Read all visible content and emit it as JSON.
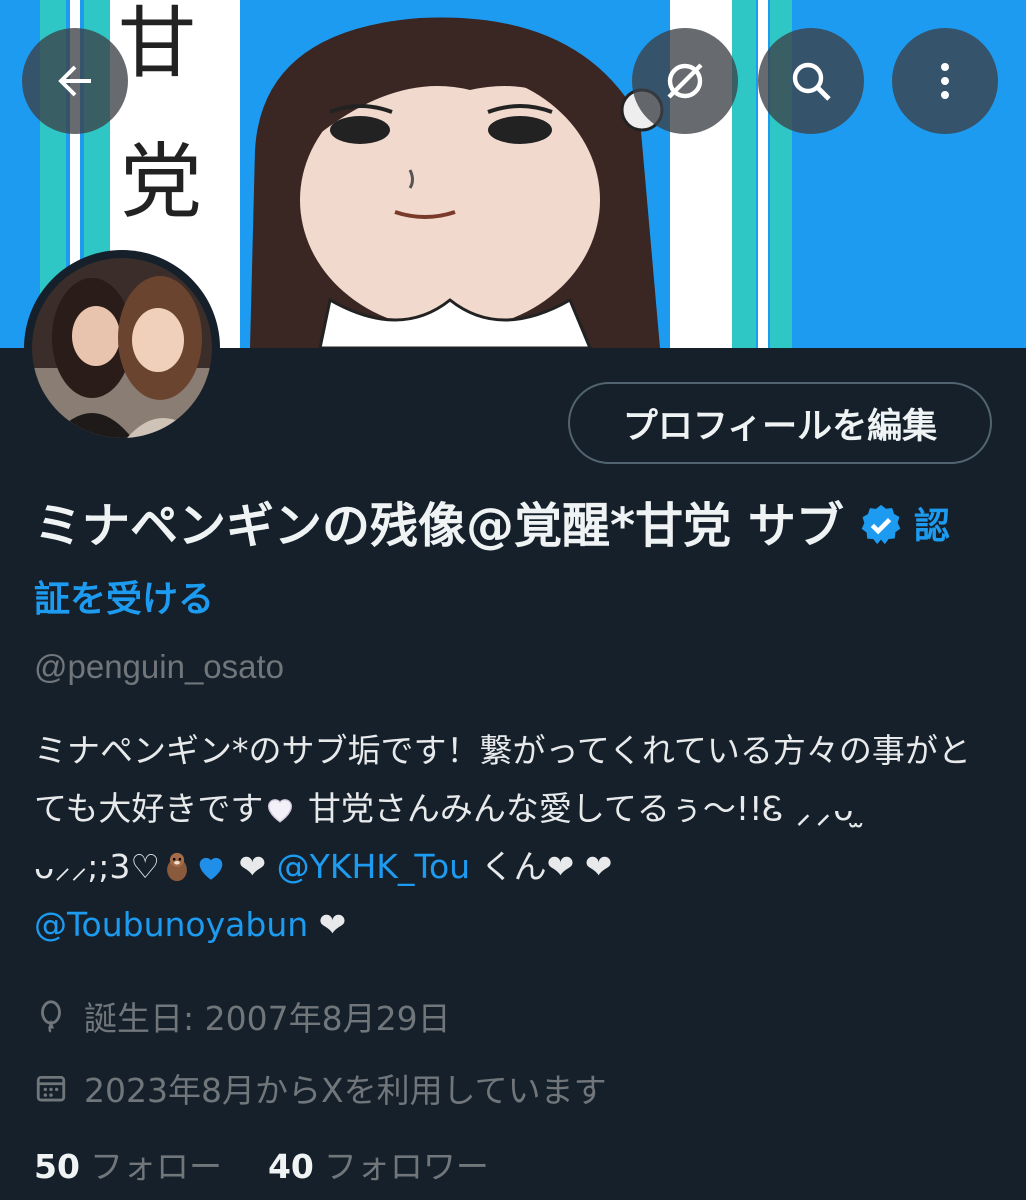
{
  "header": {
    "back_icon": "arrow-left-icon",
    "grok_icon": "grok-icon",
    "search_icon": "search-icon",
    "more_icon": "more-vertical-icon"
  },
  "banner": {
    "text_1": "甘",
    "text_2": "党"
  },
  "profile": {
    "edit_button": "プロフィールを編集",
    "display_name": "ミナペンギンの残像@覚醒*甘党 サブ",
    "verify_cta": "認証を受ける",
    "handle": "@penguin_osato"
  },
  "bio": {
    "line1": "ミナペンギン*のサブ垢です！繋がってくれている方々の事がとても大好きです",
    "line2": " 甘党さんみんな愛してるぅ〜!!Ꮛ ⸝⸝ᴗ ̫ ᴗ⸝⸝;;3♡",
    "heart_1": " ❤ ",
    "mention_1": "@YKHK_Tou",
    "kun": " くん❤ ❤ ",
    "mention_2": "@Toubunoyabun",
    "heart_end": " ❤"
  },
  "meta": {
    "birthday": "誕生日: 2007年8月29日",
    "joined": "2023年8月からXを利用しています"
  },
  "stats": {
    "following_count": "50",
    "following_label": "フォロー",
    "followers_count": "40",
    "followers_label": "フォロワー"
  },
  "colors": {
    "background": "#15202b",
    "accent": "#1d9bf0",
    "muted": "#71767b"
  }
}
